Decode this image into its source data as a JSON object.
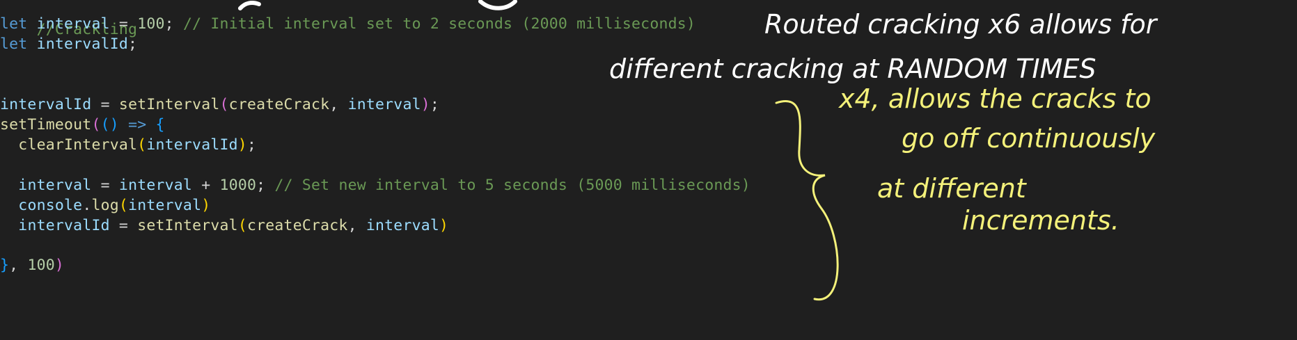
{
  "code": {
    "l1": "//Crackling",
    "l2": [
      "let",
      "interval",
      "=",
      "100",
      ";",
      "// Initial interval set to 2 seconds (2000 milliseconds)"
    ],
    "l3": [
      "let",
      "intervalId",
      ";"
    ],
    "l4": [
      "intervalId",
      "=",
      "setInterval",
      "(",
      "createCrack",
      ",",
      "interval",
      ")",
      ";"
    ],
    "l5": [
      "setTimeout",
      "(",
      "(",
      ")",
      "=>",
      "{"
    ],
    "l6": [
      "clearInterval",
      "(",
      "intervalId",
      ")",
      ";"
    ],
    "l7": [
      "interval",
      "=",
      "interval",
      "+",
      "1000",
      ";",
      "// Set new interval to 5 seconds (5000 milliseconds)"
    ],
    "l8": [
      "console",
      ".",
      "log",
      "(",
      "interval",
      ")"
    ],
    "l9": [
      "intervalId",
      "=",
      "setInterval",
      "(",
      "createCrack",
      ",",
      "interval",
      ")"
    ],
    "l10": [
      "}",
      ",",
      "100",
      ")"
    ]
  },
  "annotations": {
    "white_1": "Routed cracking x6 allows for",
    "white_2": "different cracking at RANDOM TIMES",
    "yellow_1": "x4, allows the cracks to",
    "yellow_2": "go off continuously",
    "yellow_3": "at different",
    "yellow_4": "increments.",
    "colors": {
      "white_ink": "#ffffff",
      "yellow_ink": "#f4f17a"
    }
  }
}
